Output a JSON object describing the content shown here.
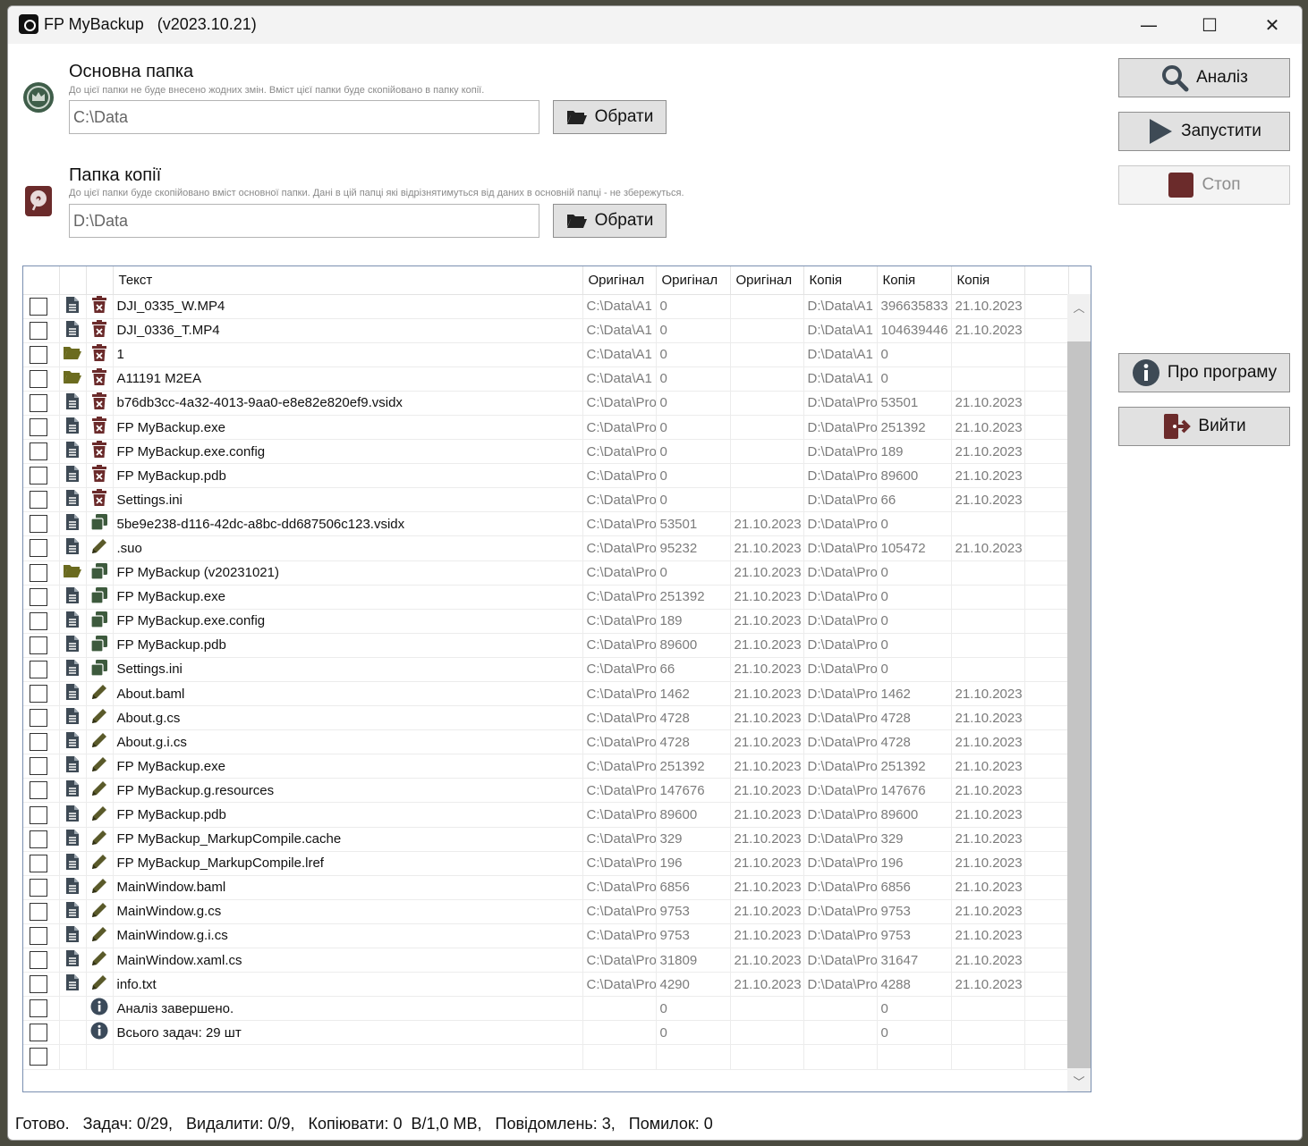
{
  "window": {
    "title": "FP MyBackup   (v2023.10.21)",
    "minimize": "—",
    "maximize": "☐",
    "close": "✕"
  },
  "source": {
    "title": "Основна папка",
    "hint": "До цієї папки не буде внесено жодних змін. Вміст цієї папки буде скопійовано в папку копії.",
    "path": "C:\\Data",
    "browse_label": "Обрати",
    "icon": "crown-badge-icon"
  },
  "target": {
    "title": "Папка копії",
    "hint": "До цієї папки буде скопійовано вміст основної папки. Дані в цій папці які відрізнятимуться від даних в основній папці - не збережуться.",
    "path": "D:\\Data",
    "browse_label": "Обрати",
    "icon": "hard-drive-icon"
  },
  "actions": {
    "analyze": "Аналіз",
    "run": "Запустити",
    "stop": "Стоп",
    "about": "Про програму",
    "exit": "Вийти"
  },
  "table": {
    "headers": [
      "Текст",
      "Оригінал",
      "Оригінал",
      "Оригінал",
      "Копія",
      "Копія",
      "Копія"
    ],
    "rows": [
      {
        "type": "file",
        "action": "delete",
        "name": "DJI_0335_W.MP4",
        "orig_path": "C:\\Data\\A1",
        "orig_size": "0",
        "orig_date": "",
        "copy_path": "D:\\Data\\A1",
        "copy_size": "396635833",
        "copy_date": "21.10.2023"
      },
      {
        "type": "file",
        "action": "delete",
        "name": "DJI_0336_T.MP4",
        "orig_path": "C:\\Data\\A1",
        "orig_size": "0",
        "orig_date": "",
        "copy_path": "D:\\Data\\A1",
        "copy_size": "104639446",
        "copy_date": "21.10.2023"
      },
      {
        "type": "folder",
        "action": "delete",
        "name": "1",
        "orig_path": "C:\\Data\\A1",
        "orig_size": "0",
        "orig_date": "",
        "copy_path": "D:\\Data\\A1",
        "copy_size": "0",
        "copy_date": ""
      },
      {
        "type": "folder",
        "action": "delete",
        "name": "A11191 M2EA",
        "orig_path": "C:\\Data\\A1",
        "orig_size": "0",
        "orig_date": "",
        "copy_path": "D:\\Data\\A1",
        "copy_size": "0",
        "copy_date": ""
      },
      {
        "type": "file",
        "action": "delete",
        "name": "b76db3cc-4a32-4013-9aa0-e8e82e820ef9.vsidx",
        "orig_path": "C:\\Data\\Pro",
        "orig_size": "0",
        "orig_date": "",
        "copy_path": "D:\\Data\\Pro",
        "copy_size": "53501",
        "copy_date": "21.10.2023"
      },
      {
        "type": "file",
        "action": "delete",
        "name": "FP MyBackup.exe",
        "orig_path": "C:\\Data\\Pro",
        "orig_size": "0",
        "orig_date": "",
        "copy_path": "D:\\Data\\Pro",
        "copy_size": "251392",
        "copy_date": "21.10.2023"
      },
      {
        "type": "file",
        "action": "delete",
        "name": "FP MyBackup.exe.config",
        "orig_path": "C:\\Data\\Pro",
        "orig_size": "0",
        "orig_date": "",
        "copy_path": "D:\\Data\\Pro",
        "copy_size": "189",
        "copy_date": "21.10.2023"
      },
      {
        "type": "file",
        "action": "delete",
        "name": "FP MyBackup.pdb",
        "orig_path": "C:\\Data\\Pro",
        "orig_size": "0",
        "orig_date": "",
        "copy_path": "D:\\Data\\Pro",
        "copy_size": "89600",
        "copy_date": "21.10.2023"
      },
      {
        "type": "file",
        "action": "delete",
        "name": "Settings.ini",
        "orig_path": "C:\\Data\\Pro",
        "orig_size": "0",
        "orig_date": "",
        "copy_path": "D:\\Data\\Pro",
        "copy_size": "66",
        "copy_date": "21.10.2023"
      },
      {
        "type": "file",
        "action": "copy",
        "name": "5be9e238-d116-42dc-a8bc-dd687506c123.vsidx",
        "orig_path": "C:\\Data\\Pro",
        "orig_size": "53501",
        "orig_date": "21.10.2023",
        "copy_path": "D:\\Data\\Pro",
        "copy_size": "0",
        "copy_date": ""
      },
      {
        "type": "file",
        "action": "edit",
        "name": ".suo",
        "orig_path": "C:\\Data\\Pro",
        "orig_size": "95232",
        "orig_date": "21.10.2023",
        "copy_path": "D:\\Data\\Pro",
        "copy_size": "105472",
        "copy_date": "21.10.2023"
      },
      {
        "type": "folder",
        "action": "copy",
        "name": "FP MyBackup (v20231021)",
        "orig_path": "C:\\Data\\Pro",
        "orig_size": "0",
        "orig_date": "21.10.2023",
        "copy_path": "D:\\Data\\Pro",
        "copy_size": "0",
        "copy_date": ""
      },
      {
        "type": "file",
        "action": "copy",
        "name": "FP MyBackup.exe",
        "orig_path": "C:\\Data\\Pro",
        "orig_size": "251392",
        "orig_date": "21.10.2023",
        "copy_path": "D:\\Data\\Pro",
        "copy_size": "0",
        "copy_date": ""
      },
      {
        "type": "file",
        "action": "copy",
        "name": "FP MyBackup.exe.config",
        "orig_path": "C:\\Data\\Pro",
        "orig_size": "189",
        "orig_date": "21.10.2023",
        "copy_path": "D:\\Data\\Pro",
        "copy_size": "0",
        "copy_date": ""
      },
      {
        "type": "file",
        "action": "copy",
        "name": "FP MyBackup.pdb",
        "orig_path": "C:\\Data\\Pro",
        "orig_size": "89600",
        "orig_date": "21.10.2023",
        "copy_path": "D:\\Data\\Pro",
        "copy_size": "0",
        "copy_date": ""
      },
      {
        "type": "file",
        "action": "copy",
        "name": "Settings.ini",
        "orig_path": "C:\\Data\\Pro",
        "orig_size": "66",
        "orig_date": "21.10.2023",
        "copy_path": "D:\\Data\\Pro",
        "copy_size": "0",
        "copy_date": ""
      },
      {
        "type": "file",
        "action": "edit",
        "name": "About.baml",
        "orig_path": "C:\\Data\\Pro",
        "orig_size": "1462",
        "orig_date": "21.10.2023",
        "copy_path": "D:\\Data\\Pro",
        "copy_size": "1462",
        "copy_date": "21.10.2023"
      },
      {
        "type": "file",
        "action": "edit",
        "name": "About.g.cs",
        "orig_path": "C:\\Data\\Pro",
        "orig_size": "4728",
        "orig_date": "21.10.2023",
        "copy_path": "D:\\Data\\Pro",
        "copy_size": "4728",
        "copy_date": "21.10.2023"
      },
      {
        "type": "file",
        "action": "edit",
        "name": "About.g.i.cs",
        "orig_path": "C:\\Data\\Pro",
        "orig_size": "4728",
        "orig_date": "21.10.2023",
        "copy_path": "D:\\Data\\Pro",
        "copy_size": "4728",
        "copy_date": "21.10.2023"
      },
      {
        "type": "file",
        "action": "edit",
        "name": "FP MyBackup.exe",
        "orig_path": "C:\\Data\\Pro",
        "orig_size": "251392",
        "orig_date": "21.10.2023",
        "copy_path": "D:\\Data\\Pro",
        "copy_size": "251392",
        "copy_date": "21.10.2023"
      },
      {
        "type": "file",
        "action": "edit",
        "name": "FP MyBackup.g.resources",
        "orig_path": "C:\\Data\\Pro",
        "orig_size": "147676",
        "orig_date": "21.10.2023",
        "copy_path": "D:\\Data\\Pro",
        "copy_size": "147676",
        "copy_date": "21.10.2023"
      },
      {
        "type": "file",
        "action": "edit",
        "name": "FP MyBackup.pdb",
        "orig_path": "C:\\Data\\Pro",
        "orig_size": "89600",
        "orig_date": "21.10.2023",
        "copy_path": "D:\\Data\\Pro",
        "copy_size": "89600",
        "copy_date": "21.10.2023"
      },
      {
        "type": "file",
        "action": "edit",
        "name": "FP MyBackup_MarkupCompile.cache",
        "orig_path": "C:\\Data\\Pro",
        "orig_size": "329",
        "orig_date": "21.10.2023",
        "copy_path": "D:\\Data\\Pro",
        "copy_size": "329",
        "copy_date": "21.10.2023"
      },
      {
        "type": "file",
        "action": "edit",
        "name": "FP MyBackup_MarkupCompile.lref",
        "orig_path": "C:\\Data\\Pro",
        "orig_size": "196",
        "orig_date": "21.10.2023",
        "copy_path": "D:\\Data\\Pro",
        "copy_size": "196",
        "copy_date": "21.10.2023"
      },
      {
        "type": "file",
        "action": "edit",
        "name": "MainWindow.baml",
        "orig_path": "C:\\Data\\Pro",
        "orig_size": "6856",
        "orig_date": "21.10.2023",
        "copy_path": "D:\\Data\\Pro",
        "copy_size": "6856",
        "copy_date": "21.10.2023"
      },
      {
        "type": "file",
        "action": "edit",
        "name": "MainWindow.g.cs",
        "orig_path": "C:\\Data\\Pro",
        "orig_size": "9753",
        "orig_date": "21.10.2023",
        "copy_path": "D:\\Data\\Pro",
        "copy_size": "9753",
        "copy_date": "21.10.2023"
      },
      {
        "type": "file",
        "action": "edit",
        "name": "MainWindow.g.i.cs",
        "orig_path": "C:\\Data\\Pro",
        "orig_size": "9753",
        "orig_date": "21.10.2023",
        "copy_path": "D:\\Data\\Pro",
        "copy_size": "9753",
        "copy_date": "21.10.2023"
      },
      {
        "type": "file",
        "action": "edit",
        "name": "MainWindow.xaml.cs",
        "orig_path": "C:\\Data\\Pro",
        "orig_size": "31809",
        "orig_date": "21.10.2023",
        "copy_path": "D:\\Data\\Pro",
        "copy_size": "31647",
        "copy_date": "21.10.2023"
      },
      {
        "type": "file",
        "action": "edit",
        "name": "info.txt",
        "orig_path": "C:\\Data\\Pro",
        "orig_size": "4290",
        "orig_date": "21.10.2023",
        "copy_path": "D:\\Data\\Pro",
        "copy_size": "4288",
        "copy_date": "21.10.2023"
      },
      {
        "type": "none",
        "action": "info",
        "name": "Аналіз завершено.",
        "orig_path": "",
        "orig_size": "0",
        "orig_date": "",
        "copy_path": "",
        "copy_size": "0",
        "copy_date": ""
      },
      {
        "type": "none",
        "action": "info",
        "name": "Всього задач: 29 шт",
        "orig_path": "",
        "orig_size": "0",
        "orig_date": "",
        "copy_path": "",
        "copy_size": "0",
        "copy_date": ""
      },
      {
        "type": "none",
        "action": "none",
        "name": "",
        "orig_path": "",
        "orig_size": "",
        "orig_date": "",
        "copy_path": "",
        "copy_size": "",
        "copy_date": ""
      }
    ]
  },
  "status": "Готово.   Задач: 0/29,   Видалити: 0/9,   Копіювати: 0  В/1,0 МВ,   Повідомлень: 3,   Помилок: 0",
  "colors": {
    "delete": "#6b2b2b",
    "copy": "#3d5a3d",
    "edit": "#5a5a2a",
    "folder": "#6b6b1f",
    "file": "#3e4a55",
    "info": "#3b4a5a",
    "stop": "#6b2b2b"
  }
}
